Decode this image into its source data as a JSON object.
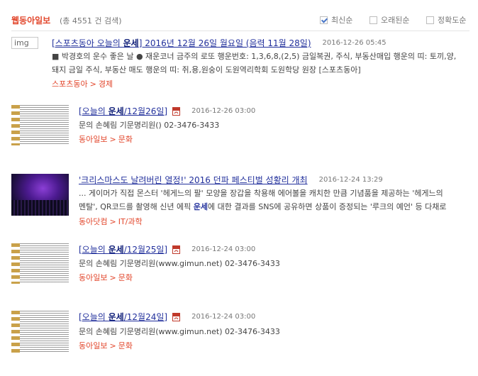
{
  "header": {
    "source": "웹동아일보",
    "count_text": "(총 4551 건 검색)",
    "sort_options": [
      {
        "label": "최신순",
        "checked": true
      },
      {
        "label": "오래된순",
        "checked": false
      },
      {
        "label": "정확도순",
        "checked": false
      }
    ]
  },
  "results": [
    {
      "thumb": "broken",
      "thumb_alt": "img",
      "title_pre": "[스포츠동아 오늘의 ",
      "title_hl": "운세",
      "title_post": "] 2016년 12월 26일 월요일 (음력 11월 28일)",
      "has_pdf": false,
      "date": "2016-12-26 05:45",
      "snippet_1": "■ 박경호의 운수 좋은 날 ● 재운코너 금주의 로또 행운번호: 1,3,6,8,(2,5) 금일복권, 주식, 부동산매입 행운의 띠: 토끼,양,",
      "snippet_2": "돼지 금일 주식, 부동산 매도 행운의 띠: 쥐,용,원숭이 도원역리학회 도원학당 원장 [스포츠동아]",
      "crumb_1": "스포츠동아",
      "crumb_2": "경제"
    },
    {
      "thumb": "news",
      "title_pre": "[오늘의 ",
      "title_hl": "운세",
      "title_post": "/12월26일]",
      "has_pdf": true,
      "date": "2016-12-26 03:00",
      "snippet_1": "문의 손혜림 기문명리원() 02-3476-3433",
      "crumb_1": "동아일보",
      "crumb_2": "문화"
    },
    {
      "thumb": "photo",
      "title_pre": "'크리스마스도 날려버린 열정!' 2016 던파 페스티벌 성황리 개최",
      "title_hl": "",
      "title_post": "",
      "has_pdf": false,
      "date": "2016-12-24 13:29",
      "snippet_1": "... 게이머가 직접 몬스터 '헤게느의 팔' 모양을 장갑을 착용해 에어볼을 캐치한 만큼 기념품을 제공하는 '헤게느의",
      "snippet_2a": "멘탈', QR코드를 촬영해 신년 에픽 ",
      "snippet_2hl": "운세",
      "snippet_2b": "에 대한 결과를 SNS에 공유하면 상품이 증정되는 '루크의 예언' 등 다채로",
      "crumb_1": "동아닷컴",
      "crumb_2": "IT/과학"
    },
    {
      "thumb": "news",
      "title_pre": "[오늘의 ",
      "title_hl": "운세",
      "title_post": "/12월25일]",
      "has_pdf": true,
      "date": "2016-12-24 03:00",
      "snippet_1": "문의 손혜림 기문명리원(www.gimun.net) 02-3476-3433",
      "crumb_1": "동아일보",
      "crumb_2": "문화"
    },
    {
      "thumb": "news",
      "title_pre": "[오늘의 ",
      "title_hl": "운세",
      "title_post": "/12월24일]",
      "has_pdf": true,
      "date": "2016-12-24 03:00",
      "snippet_1": "문의 손혜림 기문명리원(www.gimun.net) 02-3476-3433",
      "crumb_1": "동아일보",
      "crumb_2": "문화"
    }
  ],
  "colors": {
    "accent": "#e2462b",
    "link": "#22309c"
  }
}
